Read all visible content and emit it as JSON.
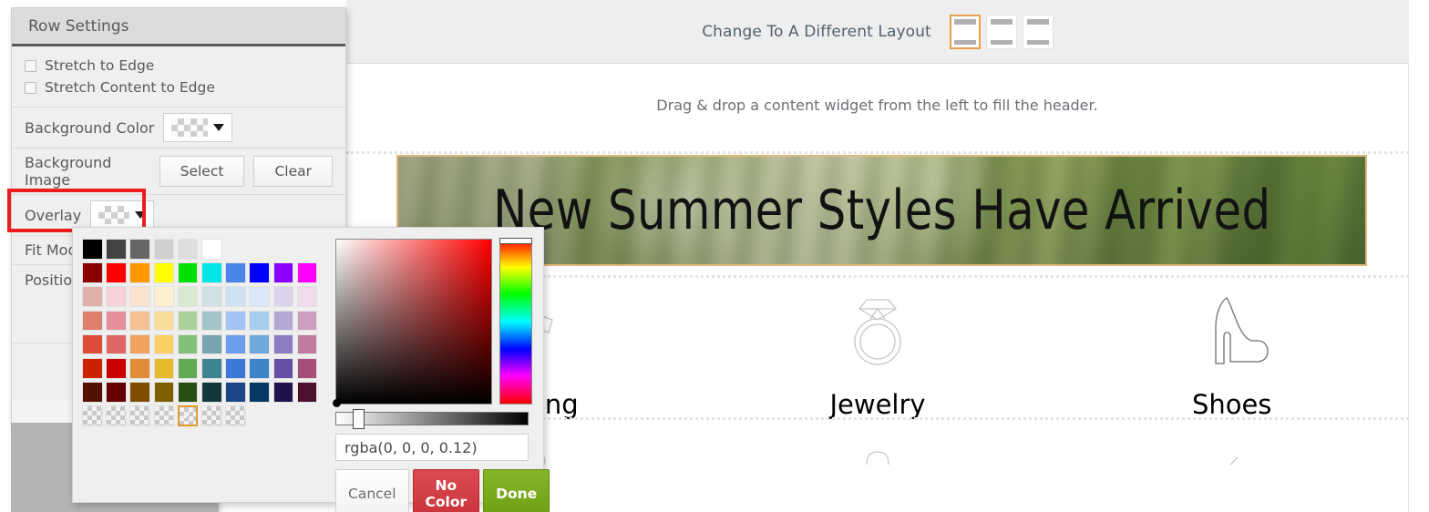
{
  "canvas": {
    "layout_switch_label": "Change To A Different Layout",
    "layout_options": [
      {
        "name": "single-column-layout",
        "selected": true
      },
      {
        "name": "left-sidebar-layout",
        "selected": false
      },
      {
        "name": "right-sidebar-layout",
        "selected": false
      }
    ],
    "drag_hint": "Drag & drop a content widget from the left to fill the header.",
    "hero_title": "New Summer Styles Have Arrived",
    "categories": [
      {
        "label": "Clothing",
        "icon": "dress-icon"
      },
      {
        "label": "Jewelry",
        "icon": "ring-icon"
      },
      {
        "label": "Shoes",
        "icon": "high-heel-shoe-icon"
      }
    ]
  },
  "panel": {
    "title": "Row Settings",
    "checkboxes": [
      {
        "label": "Stretch to Edge",
        "checked": false
      },
      {
        "label": "Stretch Content to Edge",
        "checked": false
      }
    ],
    "background_color": {
      "label": "Background Color",
      "value": "transparent"
    },
    "background_image": {
      "label": "Background Image",
      "select_label": "Select",
      "clear_label": "Clear"
    },
    "overlay": {
      "label": "Overlay",
      "value": "transparent",
      "highlighted": true
    },
    "fit_mode": {
      "label": "Fit Mode"
    },
    "position": {
      "label": "Position"
    }
  },
  "picker": {
    "color_value": "rgba(0, 0, 0, 0.12)",
    "cancel_label": "Cancel",
    "no_color_label": "No Color",
    "done_label": "Done",
    "selected_swatch_index": 4,
    "selected_swatch_row": "transparency",
    "swatch_rows": [
      [
        "#000000",
        "#444444",
        "#666666",
        "#d0d0d0",
        "#dedede",
        "#ffffff"
      ],
      [
        "#8b0000",
        "#ff0000",
        "#ff9800",
        "#ffff00",
        "#00e000",
        "#00e5e5",
        "#4a86e8",
        "#0000ff",
        "#8b00ff",
        "#ff00ff"
      ],
      [
        "#e0b0ab",
        "#f6d2d8",
        "#fbe3cf",
        "#fdf0cf",
        "#d9ead3",
        "#d0e0e3",
        "#cfe2f3",
        "#d9e7f8",
        "#dbd3ec",
        "#f0dbea"
      ],
      [
        "#dd7f6b",
        "#e58f9a",
        "#f4c193",
        "#fbdd9a",
        "#acd29a",
        "#a2c4c9",
        "#a4c2f4",
        "#a8cdec",
        "#b4a7d6",
        "#cc9ec0"
      ],
      [
        "#dd4b39",
        "#e06666",
        "#f0a25e",
        "#fbd062",
        "#84c178",
        "#76a5af",
        "#6d9eeb",
        "#6fa8dc",
        "#8e7cc3",
        "#c27ba0"
      ],
      [
        "#cc2200",
        "#cc0000",
        "#e08b36",
        "#e8b92b",
        "#63ab52",
        "#3d8491",
        "#3c78d8",
        "#3d85c6",
        "#674ea7",
        "#a64d79"
      ],
      [
        "#551100",
        "#660000",
        "#7f4c00",
        "#7f6000",
        "#274e13",
        "#12383c",
        "#1c4587",
        "#073763",
        "#20124d",
        "#4c1130"
      ],
      [
        "transparent",
        "transparent",
        "transparent",
        "transparent",
        "transparent",
        "transparent",
        "transparent"
      ]
    ]
  },
  "colors": {
    "accent_orange": "#e8a04e",
    "annotation_red": "#ee1c1c",
    "danger_red": "#cc333b",
    "success_green": "#7aa81a",
    "panel_bg": "#efefef"
  }
}
